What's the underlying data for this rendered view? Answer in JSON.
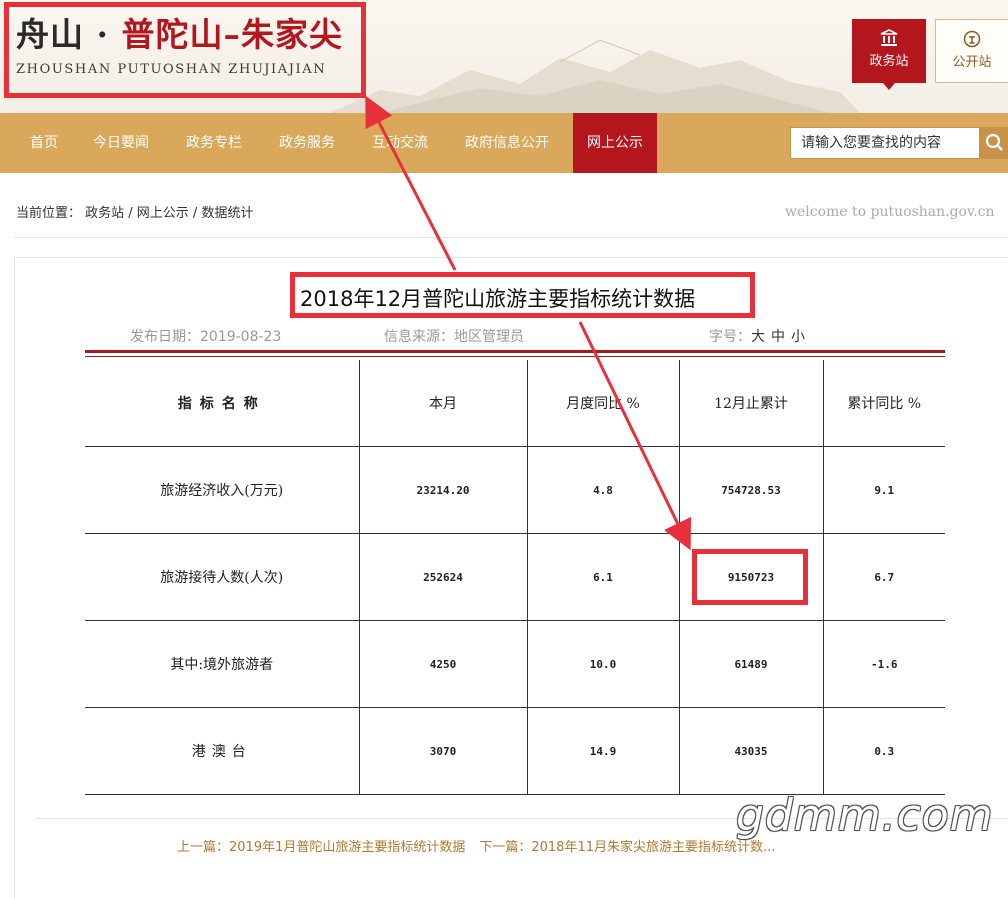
{
  "header": {
    "logo_zh_a": "舟山 · ",
    "logo_zh_b": "普陀山–朱家尖",
    "logo_en": "ZHOUSHAN PUTUOSHAN ZHUJIAJIAN",
    "btn_gov": "政务站",
    "btn_public": "公开站"
  },
  "nav": {
    "items": [
      "首页",
      "今日要闻",
      "政务专栏",
      "政务服务",
      "互动交流",
      "政府信息公开",
      "网上公示"
    ],
    "search_placeholder": "请输入您要查找的内容"
  },
  "breadcrumb": {
    "label": "当前位置：",
    "path": "政务站 / 网上公示 / 数据统计",
    "welcome": "welcome to putuoshan.gov.cn"
  },
  "article": {
    "title": "2018年12月普陀山旅游主要指标统计数据",
    "date": "发布日期：2019-08-23",
    "source": "信息来源：地区管理员",
    "font_label": "字号：",
    "font_sizes": "大中小"
  },
  "table": {
    "headers": [
      "指标名称",
      "本月",
      "月度同比 %",
      "12月止累计",
      "累计同比 %"
    ],
    "rows": [
      [
        "旅游经济收入(万元)",
        "23214.20",
        "4.8",
        "754728.53",
        "9.1"
      ],
      [
        "旅游接待人数(人次)",
        "252624",
        "6.1",
        "9150723",
        "6.7"
      ],
      [
        "其中:境外旅游者",
        "4250",
        "10.0",
        "61489",
        "-1.6"
      ],
      [
        "港澳台",
        "3070",
        "14.9",
        "43035",
        "0.3"
      ]
    ]
  },
  "prev_next": {
    "prev": "上一篇：2019年1月普陀山旅游主要指标统计数据",
    "next": "下一篇：2018年11月朱家尖旅游主要指标统计数..."
  },
  "watermark": "gdmm.com",
  "colors": {
    "brand_red": "#b3161d",
    "nav_gold": "#d9a85a",
    "annotation": "#e8303a"
  }
}
